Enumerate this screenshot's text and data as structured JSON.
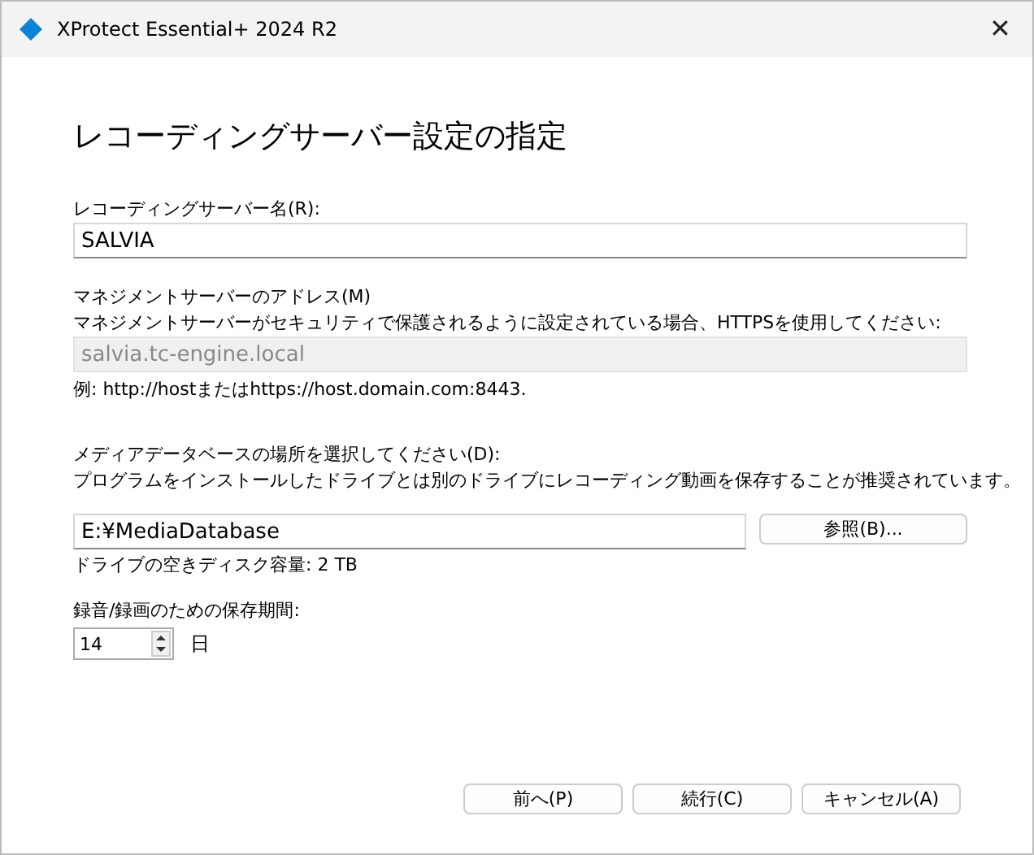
{
  "window": {
    "title": "XProtect Essential+ 2024 R2",
    "close": "✕"
  },
  "heading": "レコーディングサーバー設定の指定",
  "server_name": {
    "label": "レコーディングサーバー名(R):",
    "value": "SALVIA"
  },
  "management": {
    "label": "マネジメントサーバーのアドレス(M)",
    "note": "マネジメントサーバーがセキュリティで保護されるように設定されている場合、HTTPSを使用してください:",
    "value": "salvia.tc-engine.local",
    "disabled": true,
    "example": "例: http://hostまたはhttps://host.domain.com:8443."
  },
  "media": {
    "label": "メディアデータベースの場所を選択してください(D):",
    "note": "プログラムをインストールしたドライブとは別のドライブにレコーディング動画を保存することが推奨されています。",
    "value": "E:¥MediaDatabase",
    "browse": "参照(B)...",
    "free_space": "ドライブの空きディスク容量: 2 TB"
  },
  "retention": {
    "label": "録音/録画のための保存期間:",
    "value": "14",
    "unit": "日"
  },
  "buttons": [
    "前へ(P)",
    "続行(C)",
    "キャンセル(A)"
  ]
}
